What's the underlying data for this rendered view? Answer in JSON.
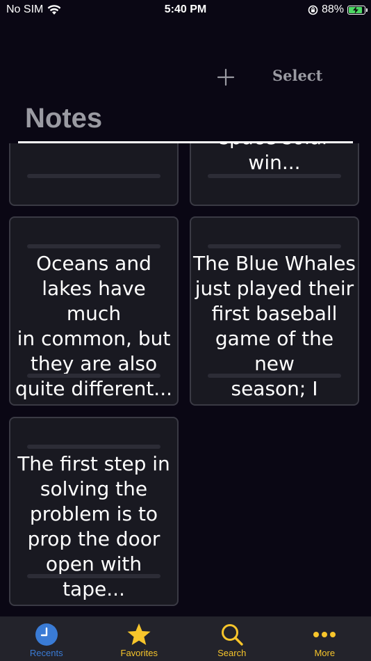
{
  "status_bar": {
    "carrier": "No SIM",
    "time": "5:40 PM",
    "battery": "88%",
    "battery_level": 0.88
  },
  "toolbar": {
    "add_icon": "plus-icon",
    "select_label": "Select"
  },
  "page_title": "Notes",
  "notes": [
    {
      "text": ""
    },
    {
      "text": "space solar win..."
    },
    {
      "text": "Oceans and\nlakes have much\nin common, but\nthey are also\nquite different..."
    },
    {
      "text": "The Blue Whales\njust played their\nfirst baseball\ngame of the new\nseason; I believ..."
    },
    {
      "text": "The first step in\nsolving the\nproblem is to\nprop the door\nopen with tape..."
    }
  ],
  "tabs": [
    {
      "label": "Recents",
      "icon": "clock-icon",
      "color": "#3a7bd5"
    },
    {
      "label": "Favorites",
      "icon": "star-icon",
      "color": "#f7c52b"
    },
    {
      "label": "Search",
      "icon": "search-icon",
      "color": "#f7c52b"
    },
    {
      "label": "More",
      "icon": "ellipsis-icon",
      "color": "#f7c52b"
    }
  ]
}
